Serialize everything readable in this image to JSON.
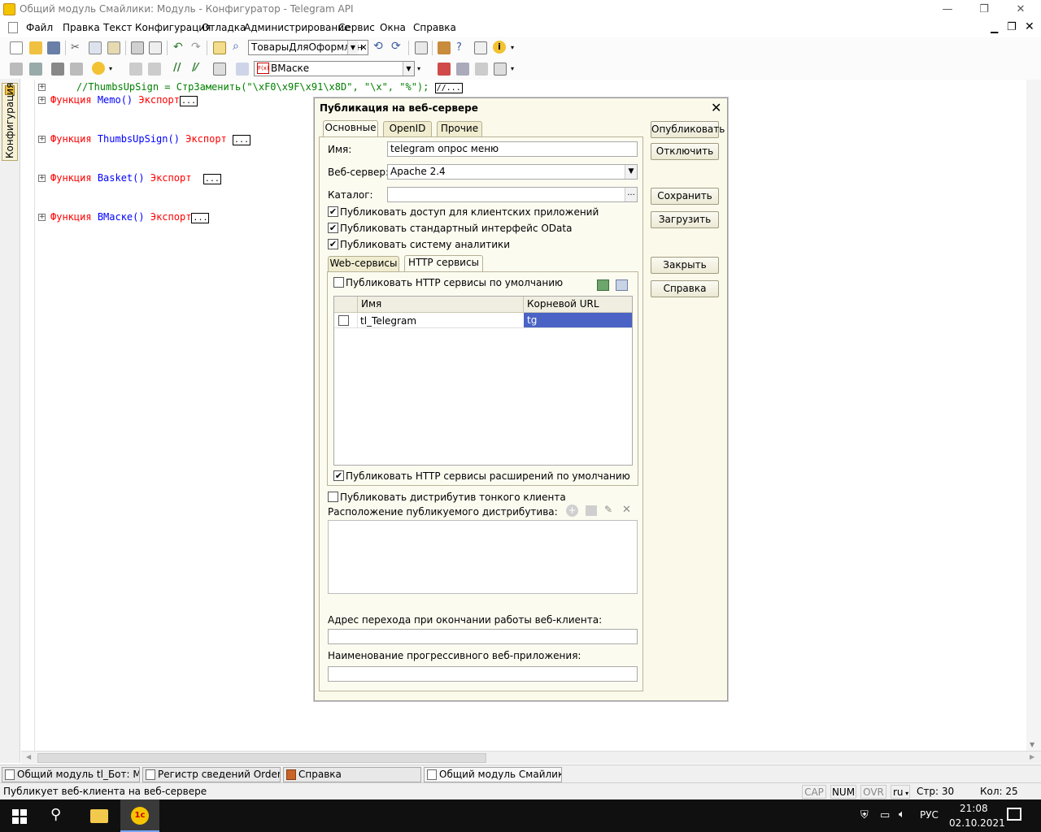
{
  "window": {
    "title": "Общий модуль Смайлики: Модуль - Конфигуратор - Telegram API",
    "minimize": "—",
    "maximize": "❐",
    "close": "✕"
  },
  "menu": [
    "Файл",
    "Правка",
    "Текст",
    "Конфигурация",
    "Отладка",
    "Администрирование",
    "Сервис",
    "Окна",
    "Справка"
  ],
  "toolbar": {
    "combo1": "ТоварыДляОформлен",
    "combo2": "ВМаске",
    "combo2_icon": "F(x)"
  },
  "left_panel": {
    "tab_label": "Конфигурация"
  },
  "editor": {
    "line0": "    //ThumbsUpSign = СтрЗаменить(\"\\xF0\\x9F\\x91\\x8D\", \"\\x\", \"%\"); ",
    "line0_tail": "//...",
    "funcs": [
      {
        "kw": "Функция",
        "name": "Memo()",
        "export": "Экспорт"
      },
      {
        "kw": "Функция",
        "name": "ThumbsUpSign()",
        "export": "Экспорт"
      },
      {
        "kw": "Функция",
        "name": "Basket()",
        "export": "Экспорт"
      },
      {
        "kw": "Функция",
        "name": "ВМаске()",
        "export": "Экспорт"
      }
    ],
    "ellipsis": "..."
  },
  "dialog": {
    "title": "Публикация на веб-сервере",
    "tabs": [
      "Основные",
      "OpenID",
      "Прочие"
    ],
    "name_label": "Имя:",
    "name_value": "telegram опрос меню",
    "server_label": "Веб-сервер:",
    "server_value": "Apache 2.4",
    "catalog_label": "Каталог:",
    "catalog_value": "",
    "catalog_btn": "...",
    "checks": [
      {
        "label": "Публиковать доступ для клиентских приложений",
        "checked": true
      },
      {
        "label": "Публиковать стандартный интерфейс OData",
        "checked": true
      },
      {
        "label": "Публиковать систему аналитики",
        "checked": true
      }
    ],
    "inner_tabs": [
      "Web-сервисы",
      "HTTP сервисы"
    ],
    "http_default_label": "Публиковать HTTP сервисы по умолчанию",
    "grid_headers": [
      "Имя",
      "Корневой URL"
    ],
    "grid_rows": [
      {
        "name": "tl_Telegram",
        "url": "tg",
        "checked": false
      }
    ],
    "ext_default_label": "Публиковать HTTP сервисы расширений по умолчанию",
    "thin_client_label": "Публиковать дистрибутив тонкого клиента",
    "distrib_label": "Расположение публикуемого дистрибутива:",
    "exit_url_label": "Адрес перехода при окончании работы веб-клиента:",
    "pwa_label": "Наименование прогрессивного веб-приложения:",
    "buttons": {
      "publish": "Опубликовать",
      "unpublish": "Отключить",
      "save": "Сохранить",
      "load": "Загрузить",
      "close": "Закрыть",
      "help": "Справка"
    }
  },
  "window_tabs": [
    "Общий модуль tl_Бот: Моду...",
    "Регистр сведений Orders: М...",
    "Справка",
    "Общий модуль Смайлики: М..."
  ],
  "status": {
    "message": "Публикует веб-клиента на веб-сервере",
    "cap": "CAP",
    "num": "NUM",
    "ovr": "OVR",
    "lang": "ru",
    "row": "Стр: 30",
    "col": "Кол: 25"
  },
  "taskbar": {
    "tray_lang": "РУС",
    "time": "21:08",
    "date": "02.10.2021"
  },
  "colors": {
    "keyword": "#ff0000",
    "function": "#0000ff",
    "comment": "#008000",
    "dialog_bg": "#fbf9ea",
    "selection": "#4a63c4"
  }
}
